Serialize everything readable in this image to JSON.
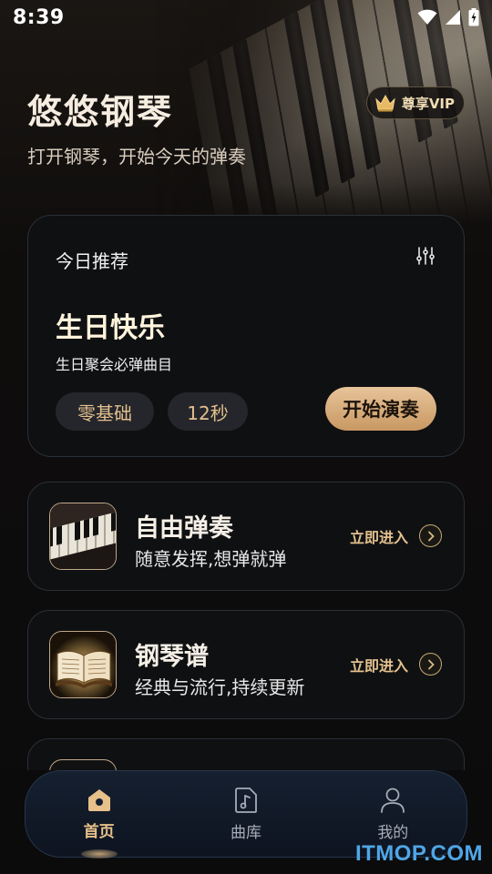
{
  "status_bar": {
    "time": "8:39"
  },
  "header": {
    "title": "悠悠钢琴",
    "subtitle": "打开钢琴，开始今天的弹奏",
    "vip_label": "尊享VIP"
  },
  "recommendation": {
    "label": "今日推荐",
    "song_title": "生日快乐",
    "song_desc": "生日聚会必弹曲目",
    "tags": [
      "零基础",
      "12秒"
    ],
    "start_label": "开始演奏"
  },
  "features": [
    {
      "title": "自由弹奏",
      "desc": "随意发挥,想弹就弹",
      "enter_label": "立即进入",
      "icon": "piano-keys-thumbnail"
    },
    {
      "title": "钢琴谱",
      "desc": "经典与流行,持续更新",
      "enter_label": "立即进入",
      "icon": "open-book-thumbnail"
    }
  ],
  "bottom_nav": [
    {
      "label": "首页",
      "icon": "home-icon",
      "active": true
    },
    {
      "label": "曲库",
      "icon": "music-library-icon",
      "active": false
    },
    {
      "label": "我的",
      "icon": "user-icon",
      "active": false
    }
  ],
  "watermark": "ITMOP.COM",
  "colors": {
    "accent_gold": "#e3c08e",
    "button_gradient_start": "#e7c49a",
    "button_gradient_end": "#c89862",
    "card_border": "#2a3038",
    "nav_bg": "#152030"
  }
}
